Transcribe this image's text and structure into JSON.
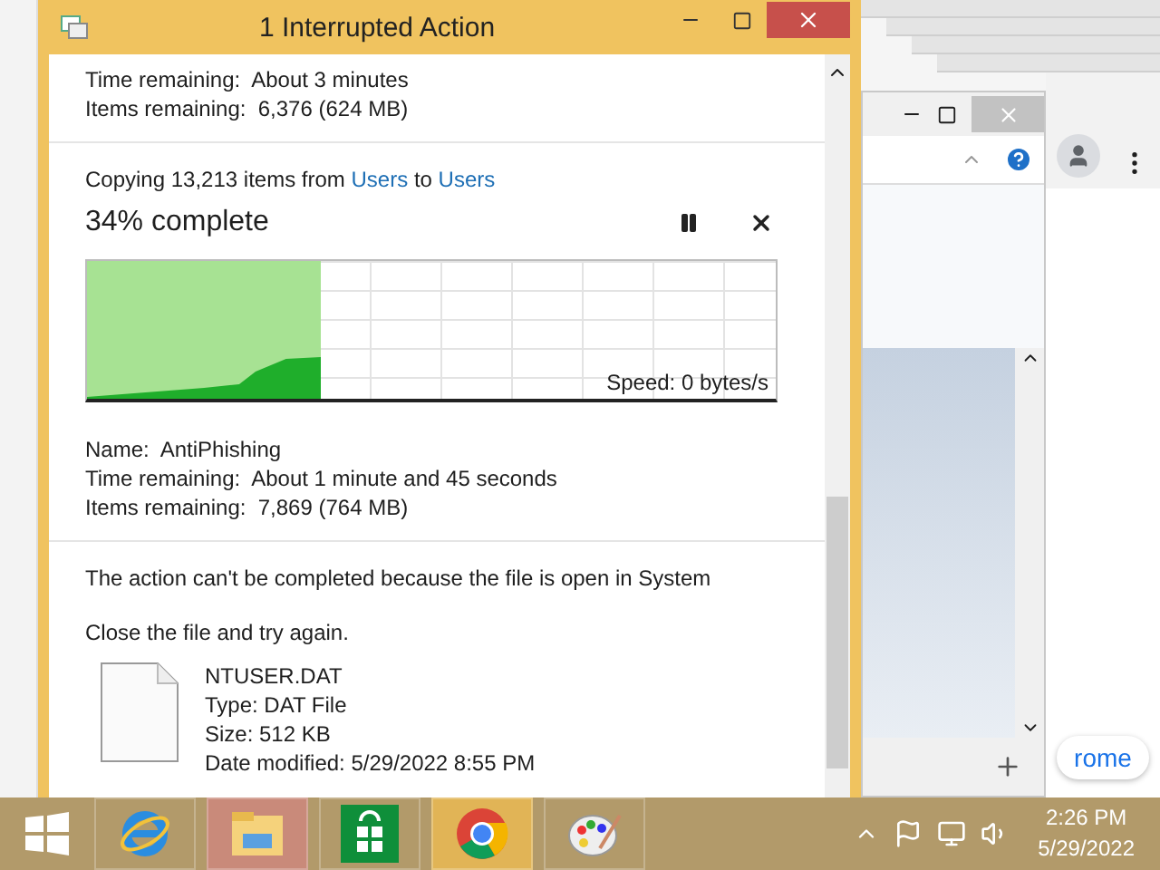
{
  "dialog": {
    "title": "1 Interrupted Action",
    "previous": {
      "lines": [
        {
          "label": "Time remaining:",
          "value": "About 3 minutes"
        },
        {
          "label": "Items remaining:",
          "value": "6,376 (624 MB)"
        }
      ]
    },
    "copy": {
      "prefix": "Copying 13,213 items from",
      "source": "Users",
      "middle": "to",
      "target": "Users",
      "percent": "34% complete",
      "level": 0.34,
      "speed": "Speed: 0 bytes/s",
      "lines": [
        {
          "label": "Name:",
          "value": "AntiPhishing"
        },
        {
          "label": "Time remaining:",
          "value": "About 1 minute and 45 seconds"
        },
        {
          "label": "Items remaining:",
          "value": "7,869 (764 MB)"
        }
      ]
    },
    "error": {
      "message": "The action can't be completed because the file is open in System",
      "hint": "Close the file and try again.",
      "file": {
        "name": "NTUSER.DAT",
        "details": [
          "Type: DAT File",
          "Size: 512 KB",
          "Date modified: 5/29/2022 8:55 PM"
        ]
      }
    }
  },
  "background": {
    "chrome_text": "rome"
  },
  "taskbar": {
    "apps": [
      {
        "kind": "ie",
        "highlighted": false
      },
      {
        "kind": "explorer",
        "highlighted": true
      },
      {
        "kind": "store",
        "highlighted": false
      },
      {
        "kind": "chrome",
        "highlighted": true
      },
      {
        "kind": "paint",
        "highlighted": false
      }
    ],
    "time": "2:26 PM",
    "date": "5/29/2022"
  }
}
